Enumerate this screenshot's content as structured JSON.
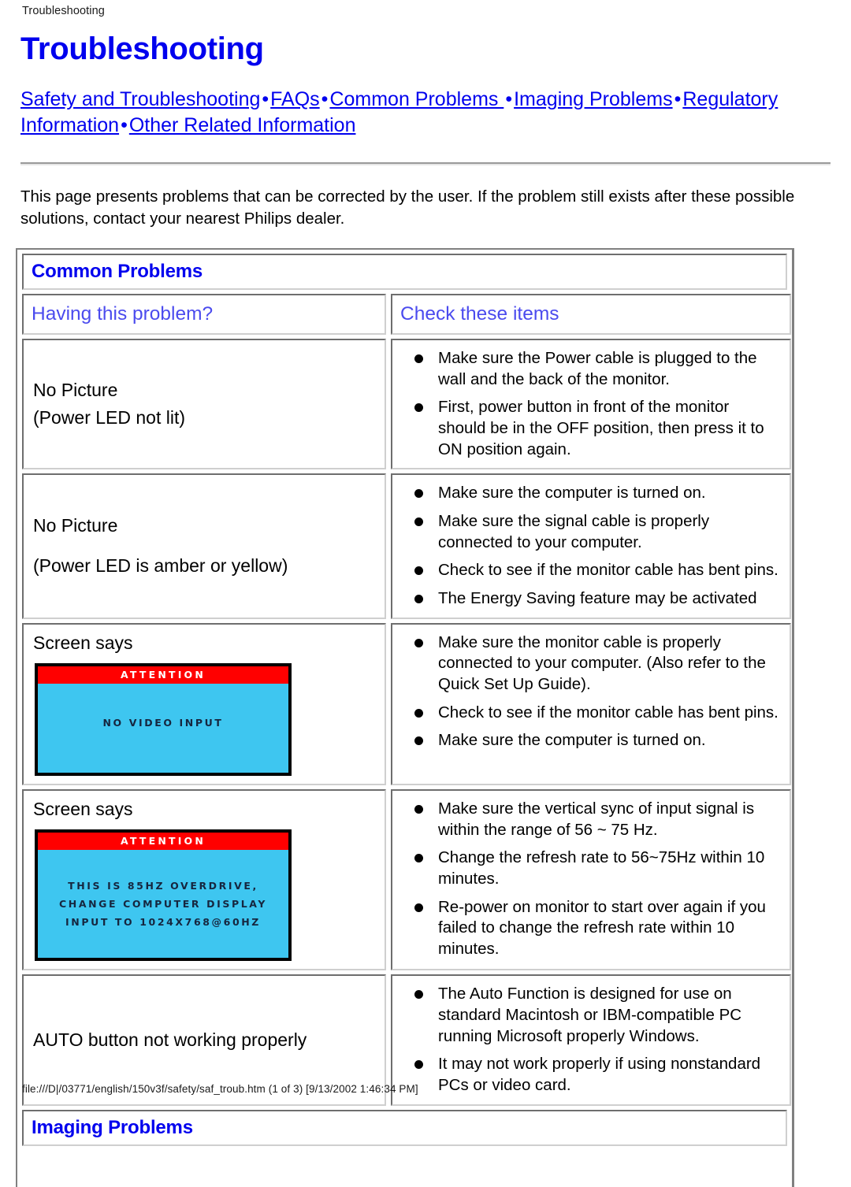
{
  "browser": {
    "print_header": "Troubleshooting",
    "print_footer": "file:///D|/03771/english/150v3f/safety/saf_troub.htm (1 of 3) [9/13/2002 1:46:34 PM]"
  },
  "page": {
    "title": "Troubleshooting",
    "intro": "This page presents problems that can be corrected by the user. If the problem still exists after these possible solutions, contact your nearest Philips dealer."
  },
  "nav": {
    "separator": "•",
    "links": [
      "Safety and Troubleshooting",
      "FAQs",
      "Common Problems ",
      "Imaging Problems",
      "Regulatory Information",
      "Other Related Information"
    ]
  },
  "table": {
    "section_heading": "Common Problems",
    "columns": {
      "left": "Having this problem?",
      "right": "Check these items"
    },
    "rows": [
      {
        "problem_lines": [
          "No Picture",
          "(Power LED not lit)"
        ],
        "checks": [
          "Make sure the Power cable is plugged to the wall and the back of the monitor.",
          "First, power button in front of the monitor should be in the OFF position, then press it to ON position again."
        ]
      },
      {
        "problem_lines": [
          "No Picture",
          "(Power LED is amber or yellow)"
        ],
        "checks": [
          "Make sure the computer is turned on.",
          "Make sure the signal cable is properly connected to your computer.",
          "Check to see if the monitor cable has bent pins.",
          "The Energy Saving feature may be activated"
        ]
      },
      {
        "problem_label": "Screen says",
        "osd": {
          "title": "ATTENTION",
          "message_lines": [
            "NO VIDEO INPUT"
          ],
          "title_bg": "#ff0000",
          "screen_bg": "#3ec6f0",
          "text_color": "#16263f"
        },
        "checks": [
          "Make sure the monitor cable is properly connected to your computer. (Also refer to the Quick Set Up Guide).",
          "Check to see if the monitor cable has bent pins.",
          "Make sure the computer is turned on."
        ]
      },
      {
        "problem_label": "Screen says",
        "osd": {
          "title": "ATTENTION",
          "message_lines": [
            "THIS IS 85HZ OVERDRIVE,",
            "CHANGE COMPUTER DISPLAY",
            "INPUT TO 1024X768@60HZ"
          ],
          "title_bg": "#ff0000",
          "screen_bg": "#3ec6f0",
          "text_color": "#16263f"
        },
        "checks": [
          "Make sure the vertical sync of input signal is within the range of 56 ~ 75 Hz.",
          "Change the refresh rate to 56~75Hz within 10 minutes.",
          "Re-power on monitor to start over again if you failed to change the refresh rate within 10 minutes."
        ]
      },
      {
        "problem_lines": [
          "AUTO button not working properly"
        ],
        "checks": [
          "The Auto Function is designed for use on standard Macintosh or IBM-compatible PC running Microsoft properly Windows.",
          "It may not work properly if using nonstandard PCs or video card."
        ]
      }
    ],
    "next_section_heading": "Imaging Problems"
  },
  "colors": {
    "link_blue": "#0000ee",
    "header_blue": "#4b4bee",
    "heading_blue": "#0000ee",
    "border_gray": "#808080"
  }
}
